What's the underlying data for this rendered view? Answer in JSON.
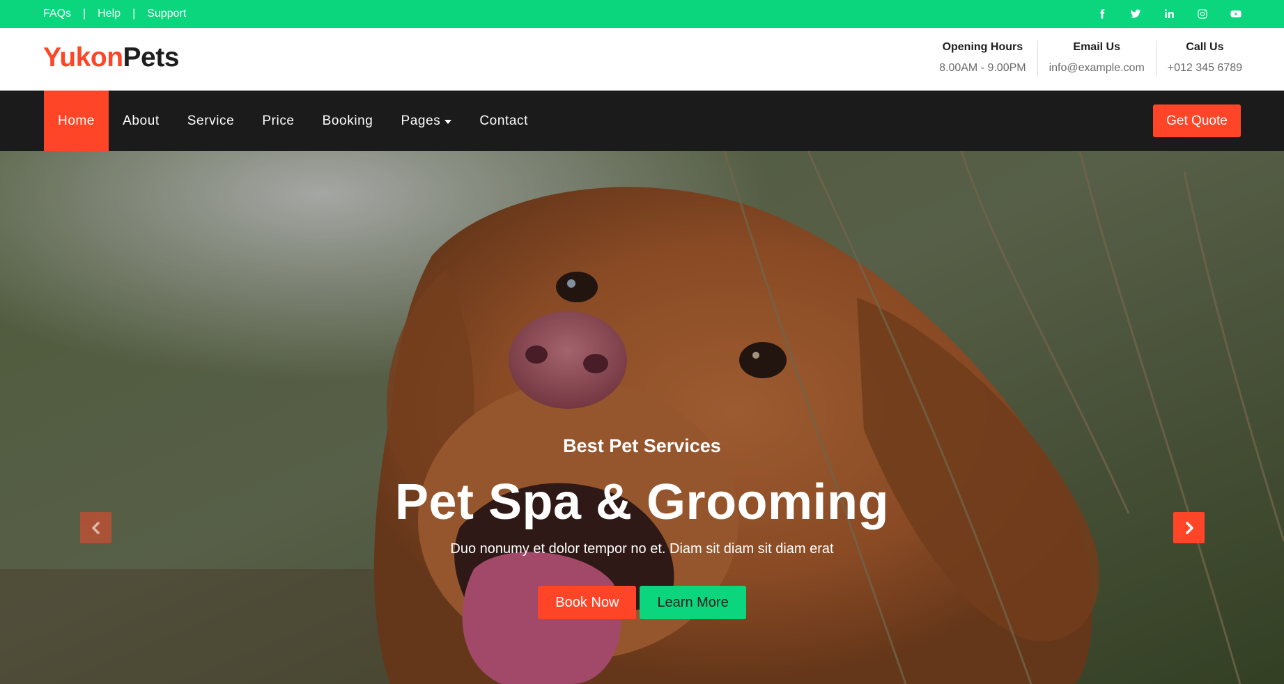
{
  "topbar": {
    "links": [
      "FAQs",
      "Help",
      "Support"
    ],
    "separator": "|",
    "socials": [
      "facebook-icon",
      "twitter-icon",
      "linkedin-icon",
      "instagram-icon",
      "youtube-icon"
    ]
  },
  "header": {
    "logo_part1": "Yukon",
    "logo_part2": "Pets",
    "contacts": [
      {
        "title": "Opening Hours",
        "value": "8.00AM - 9.00PM"
      },
      {
        "title": "Email Us",
        "value": "info@example.com"
      },
      {
        "title": "Call Us",
        "value": "+012 345 6789"
      }
    ]
  },
  "nav": {
    "items": [
      {
        "label": "Home"
      },
      {
        "label": "About"
      },
      {
        "label": "Service"
      },
      {
        "label": "Price"
      },
      {
        "label": "Booking"
      },
      {
        "label": "Pages"
      },
      {
        "label": "Contact"
      }
    ],
    "active": "Home",
    "cta": "Get Quote"
  },
  "hero": {
    "subtitle": "Best Pet Services",
    "title": "Pet Spa & Grooming",
    "description": "Duo nonumy et dolor tempor no et. Diam sit diam sit diam erat",
    "book_label": "Book Now",
    "learn_label": "Learn More",
    "prev_icon": "chevron-left-icon",
    "next_icon": "chevron-right-icon"
  },
  "colors": {
    "accent": "#ff4527",
    "green": "#0bd57d",
    "nav_bg": "#1b1b1b"
  }
}
